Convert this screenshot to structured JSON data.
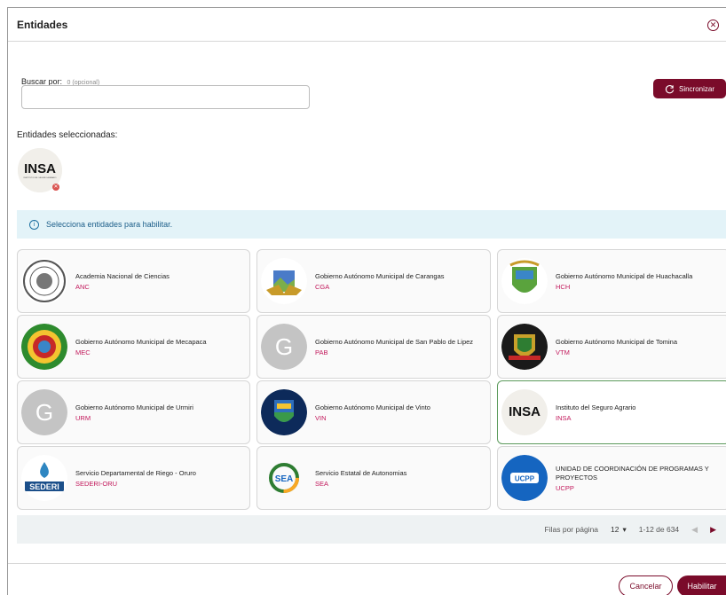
{
  "dialog": {
    "title": "Entidades",
    "close_icon": "close-icon"
  },
  "search": {
    "label": "Buscar por:",
    "count": "0",
    "optional": "(opcional)",
    "value": "",
    "placeholder": ""
  },
  "sync_button": {
    "label": "Sincronizar",
    "icon": "sync-icon"
  },
  "selected": {
    "label": "Entidades seleccionadas:",
    "items": [
      {
        "logo_text": "INSA",
        "logo_subtext": "INSTITUTO DEL SEGURO AGRARIO"
      }
    ]
  },
  "info": {
    "text": "Selecciona entidades para habilitar.",
    "icon": "info-icon"
  },
  "entities": [
    {
      "name": "Academia Nacional de Ciencias",
      "code": "ANC",
      "logo": "seal"
    },
    {
      "name": "Gobierno Autónomo Municipal de Carangas",
      "code": "CGA",
      "logo": "crest"
    },
    {
      "name": "Gobierno Autónomo Municipal de Huachacalla",
      "code": "HCH",
      "logo": "shield"
    },
    {
      "name": "Gobierno Autónomo Municipal de Mecapaca",
      "code": "MEC",
      "logo": "emblem"
    },
    {
      "name": "Gobierno Autónomo Municipal de San Pablo de Lipez",
      "code": "PAB",
      "logo": "G"
    },
    {
      "name": "Gobierno Autónomo Municipal de Tomina",
      "code": "VTM",
      "logo": "dark-shield"
    },
    {
      "name": "Gobierno Autónomo Municipal de Urmiri",
      "code": "URM",
      "logo": "G"
    },
    {
      "name": "Gobierno Autónomo Municipal de Vinto",
      "code": "VIN",
      "logo": "blue-shield"
    },
    {
      "name": "Instituto del Seguro Agrario",
      "code": "INSA",
      "logo": "INSA",
      "selected": true
    },
    {
      "name": "Servicio Departamental de Riego - Oruro",
      "code": "SEDERI-ORU",
      "logo": "SEDERI"
    },
    {
      "name": "Servicio Estatal de Autonomias",
      "code": "SEA",
      "logo": "SEA"
    },
    {
      "name": "UNIDAD DE COORDINACIÓN DE PROGRAMAS Y PROYECTOS",
      "code": "UCPP",
      "logo": "UCPP"
    }
  ],
  "pagination": {
    "rows_label": "Filas por página",
    "rows_value": "12",
    "range": "1-12 de 634"
  },
  "footer": {
    "cancel_label": "Cancelar",
    "ok_label": "Habilitar"
  },
  "colors": {
    "primary": "#7a0b2a",
    "code": "#c2185b",
    "info_bg": "#e3f3f8",
    "selected_border": "#5b9a5b"
  }
}
